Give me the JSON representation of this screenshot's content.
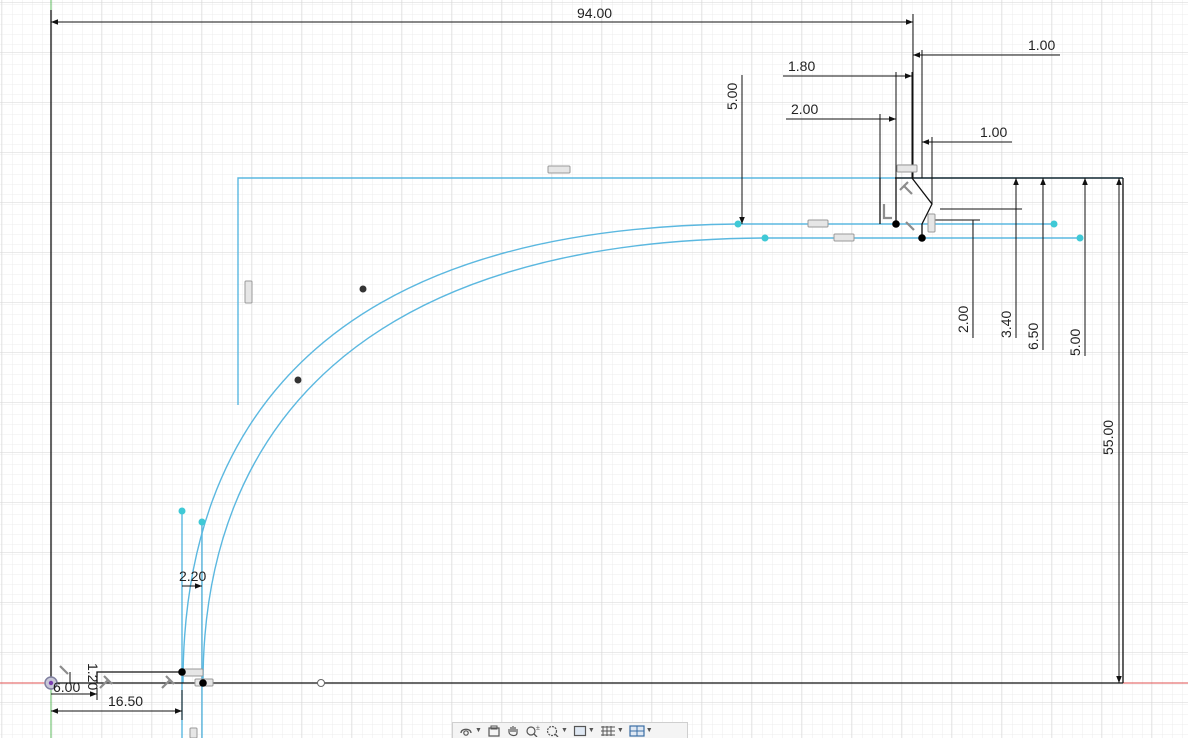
{
  "sketch": {
    "dimensions": {
      "overall_width": "94.00",
      "top_offset_180": "1.80",
      "top_offset_100": "1.00",
      "top_offset_200": "2.00",
      "mid_offset_100": "1.00",
      "vertical_500_top": "5.00",
      "vertical_200": "2.00",
      "vertical_340": "3.40",
      "vertical_650": "6.50",
      "vertical_500_right": "5.00",
      "overall_height": "55.00",
      "bottom_width_220": "2.20",
      "bottom_left_1650": "16.50",
      "bottom_left_600": "6.00",
      "bottom_left_120": "1.20"
    },
    "colors": {
      "grid_minor": "#ececec",
      "grid_major": "#d6d6d6",
      "sketch_line": "#5bb8e0",
      "dimension_line": "#111111",
      "axis_x": "#e05050",
      "axis_y": "#5cb85c"
    }
  },
  "toolbar": {
    "items": [
      {
        "icon": "orbit-icon"
      },
      {
        "icon": "look-at-icon"
      },
      {
        "icon": "pan-hand-icon"
      },
      {
        "icon": "zoom-icon"
      },
      {
        "icon": "zoom-window-icon"
      },
      {
        "icon": "display-settings-icon"
      },
      {
        "icon": "grid-icon"
      },
      {
        "icon": "viewports-icon"
      }
    ]
  }
}
